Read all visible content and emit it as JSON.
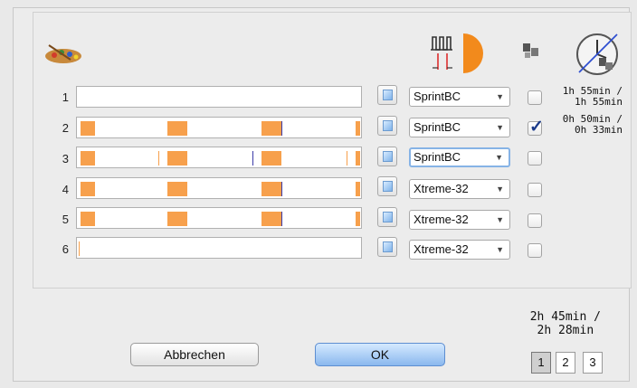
{
  "rows": [
    {
      "number": "1",
      "preset": "SprintBC",
      "checked": false
    },
    {
      "number": "2",
      "preset": "SprintBC",
      "checked": true
    },
    {
      "number": "3",
      "preset": "SprintBC",
      "checked": false
    },
    {
      "number": "4",
      "preset": "Xtreme-32",
      "checked": false
    },
    {
      "number": "5",
      "preset": "Xtreme-32",
      "checked": false
    },
    {
      "number": "6",
      "preset": "Xtreme-32",
      "checked": false
    }
  ],
  "times": {
    "row1_line1": "1h 55min /",
    "row1_line2": "1h 55min",
    "row2_line1": "0h 50min /",
    "row2_line2": "0h 33min"
  },
  "total": {
    "line1": "2h 45min /",
    "line2": "2h 28min"
  },
  "buttons": {
    "cancel": "Abbrechen",
    "ok": "OK"
  },
  "pages": [
    "1",
    "2",
    "3"
  ],
  "active_page": "1",
  "icons": {
    "palette": "palette-icon",
    "filter": "filter-lens-icon",
    "printer_small": "printer-icon",
    "clock_disabled": "clock-disabled-icon",
    "preview_button": "preview-sheet-icon",
    "dropdown": "chevron-down-icon"
  },
  "colors": {
    "segment": "#f7a04c",
    "marker": "#3b3ba8",
    "check": "#1b3a8a",
    "ok_button": "#8ab8ee"
  }
}
